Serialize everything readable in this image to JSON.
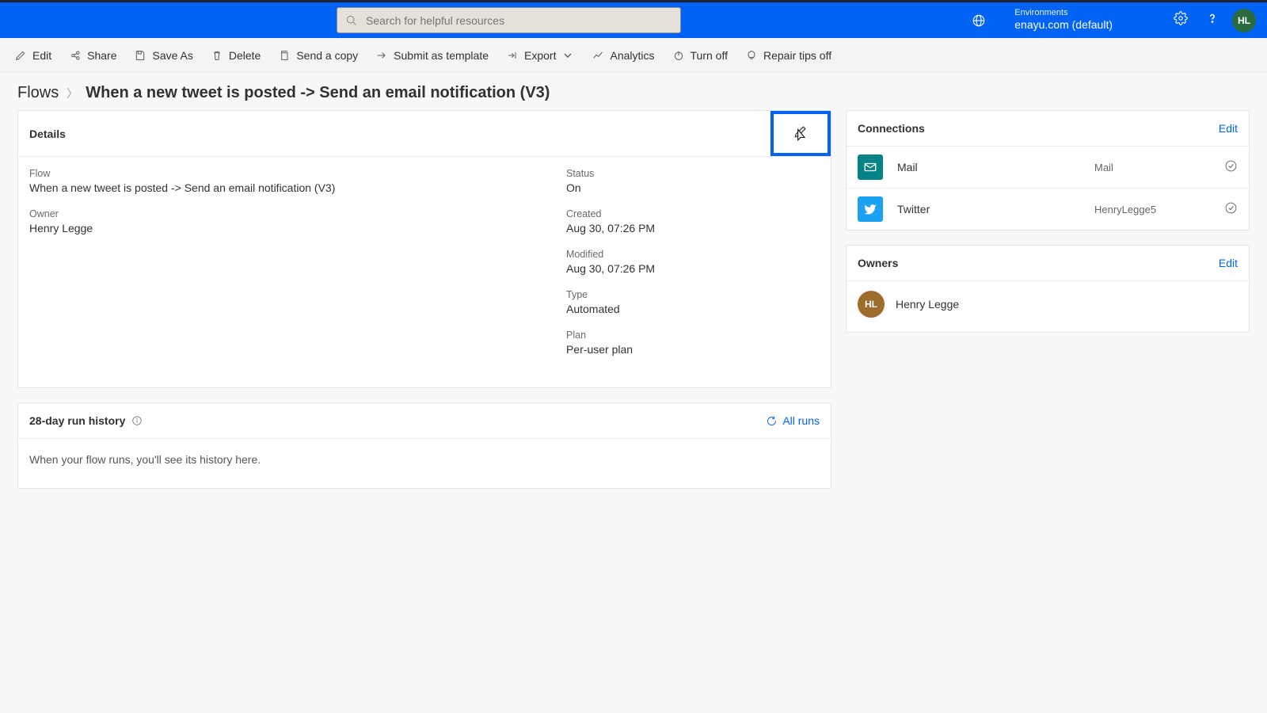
{
  "topbar": {
    "search_placeholder": "Search for helpful resources",
    "env_label": "Environments",
    "env_value": "enayu.com (default)",
    "avatar": "HL"
  },
  "cmdbar": {
    "edit": "Edit",
    "share": "Share",
    "save_as": "Save As",
    "delete": "Delete",
    "send_copy": "Send a copy",
    "submit_template": "Submit as template",
    "export": "Export",
    "analytics": "Analytics",
    "turn_off": "Turn off",
    "repair_tips": "Repair tips off"
  },
  "breadcrumb": {
    "root": "Flows",
    "leaf": "When a new tweet is posted -> Send an email notification (V3)"
  },
  "details": {
    "title": "Details",
    "flow_label": "Flow",
    "flow_value": "When a new tweet is posted -> Send an email notification (V3)",
    "owner_label": "Owner",
    "owner_value": "Henry Legge",
    "status_label": "Status",
    "status_value": "On",
    "created_label": "Created",
    "created_value": "Aug 30, 07:26 PM",
    "modified_label": "Modified",
    "modified_value": "Aug 30, 07:26 PM",
    "type_label": "Type",
    "type_value": "Automated",
    "plan_label": "Plan",
    "plan_value": "Per-user plan"
  },
  "run_history": {
    "title": "28-day run history",
    "all_runs": "All runs",
    "empty": "When your flow runs, you'll see its history here."
  },
  "connections": {
    "title": "Connections",
    "edit": "Edit",
    "rows": [
      {
        "name": "Mail",
        "account": "Mail"
      },
      {
        "name": "Twitter",
        "account": "HenryLegge5"
      }
    ]
  },
  "owners": {
    "title": "Owners",
    "edit": "Edit",
    "avatar": "HL",
    "name": "Henry Legge"
  }
}
